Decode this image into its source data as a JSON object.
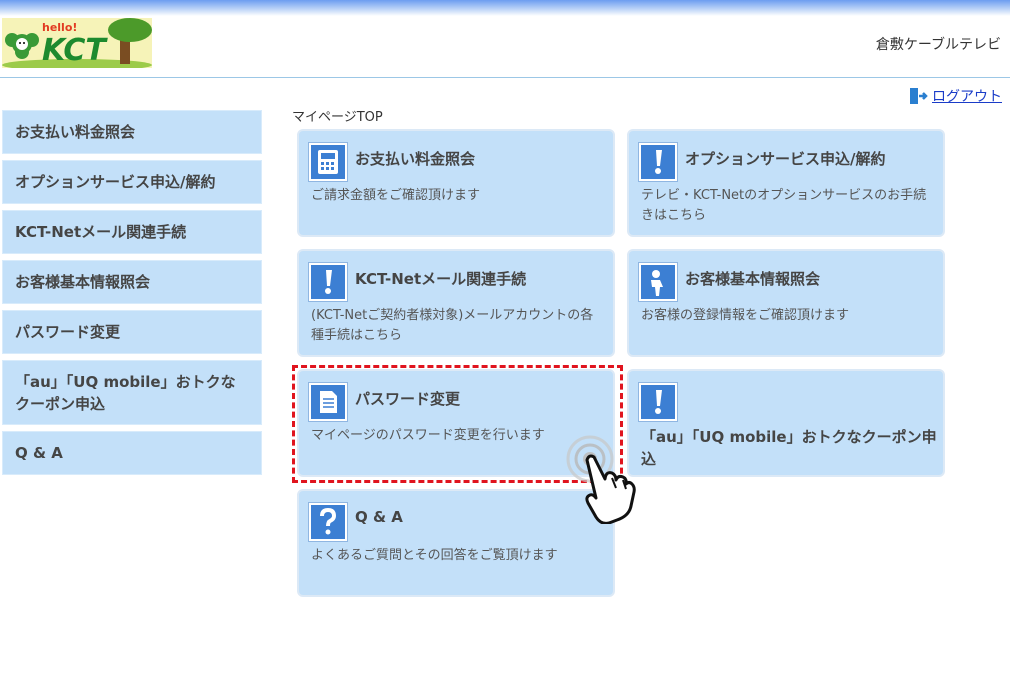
{
  "header": {
    "logo_text": "KCT",
    "logo_hello": "hello!",
    "company_name": "倉敷ケーブルテレビ"
  },
  "logout": {
    "label": "ログアウト"
  },
  "breadcrumb": "マイページTOP",
  "sidebar": {
    "items": [
      {
        "label": "お支払い料金照会"
      },
      {
        "label": "オプションサービス申込/解約"
      },
      {
        "label": "KCT-Netメール関連手続"
      },
      {
        "label": "お客様基本情報照会"
      },
      {
        "label": "パスワード変更"
      },
      {
        "label": "「au」「UQ mobile」おトクなクーポン申込"
      },
      {
        "label": "Q & A"
      }
    ]
  },
  "cards": [
    {
      "title": "お支払い料金照会",
      "desc": "ご請求金額をご確認頂けます",
      "icon": "calculator-icon"
    },
    {
      "title": "オプションサービス申込/解約",
      "desc": "テレビ・KCT-Netのオプションサービスのお手続きはこちら",
      "icon": "exclamation-icon"
    },
    {
      "title": "KCT-Netメール関連手続",
      "desc": "(KCT-Netご契約者様対象)メールアカウントの各種手続はこちら",
      "icon": "exclamation-icon"
    },
    {
      "title": "お客様基本情報照会",
      "desc": "お客様の登録情報をご確認頂けます",
      "icon": "person-icon"
    },
    {
      "title": "パスワード変更",
      "desc": "マイページのパスワード変更を行います",
      "icon": "document-icon"
    },
    {
      "title": "「au」「UQ mobile」おトクなクーポン申込",
      "desc": "",
      "icon": "exclamation-icon"
    },
    {
      "title": "Q & A",
      "desc": "よくあるご質問とその回答をご覧頂けます",
      "icon": "question-icon"
    }
  ],
  "colors": {
    "card_bg": "#c3e0f9",
    "icon_bg": "#3c7fd3",
    "highlight": "#e0141e",
    "link": "#1a3cc8"
  }
}
